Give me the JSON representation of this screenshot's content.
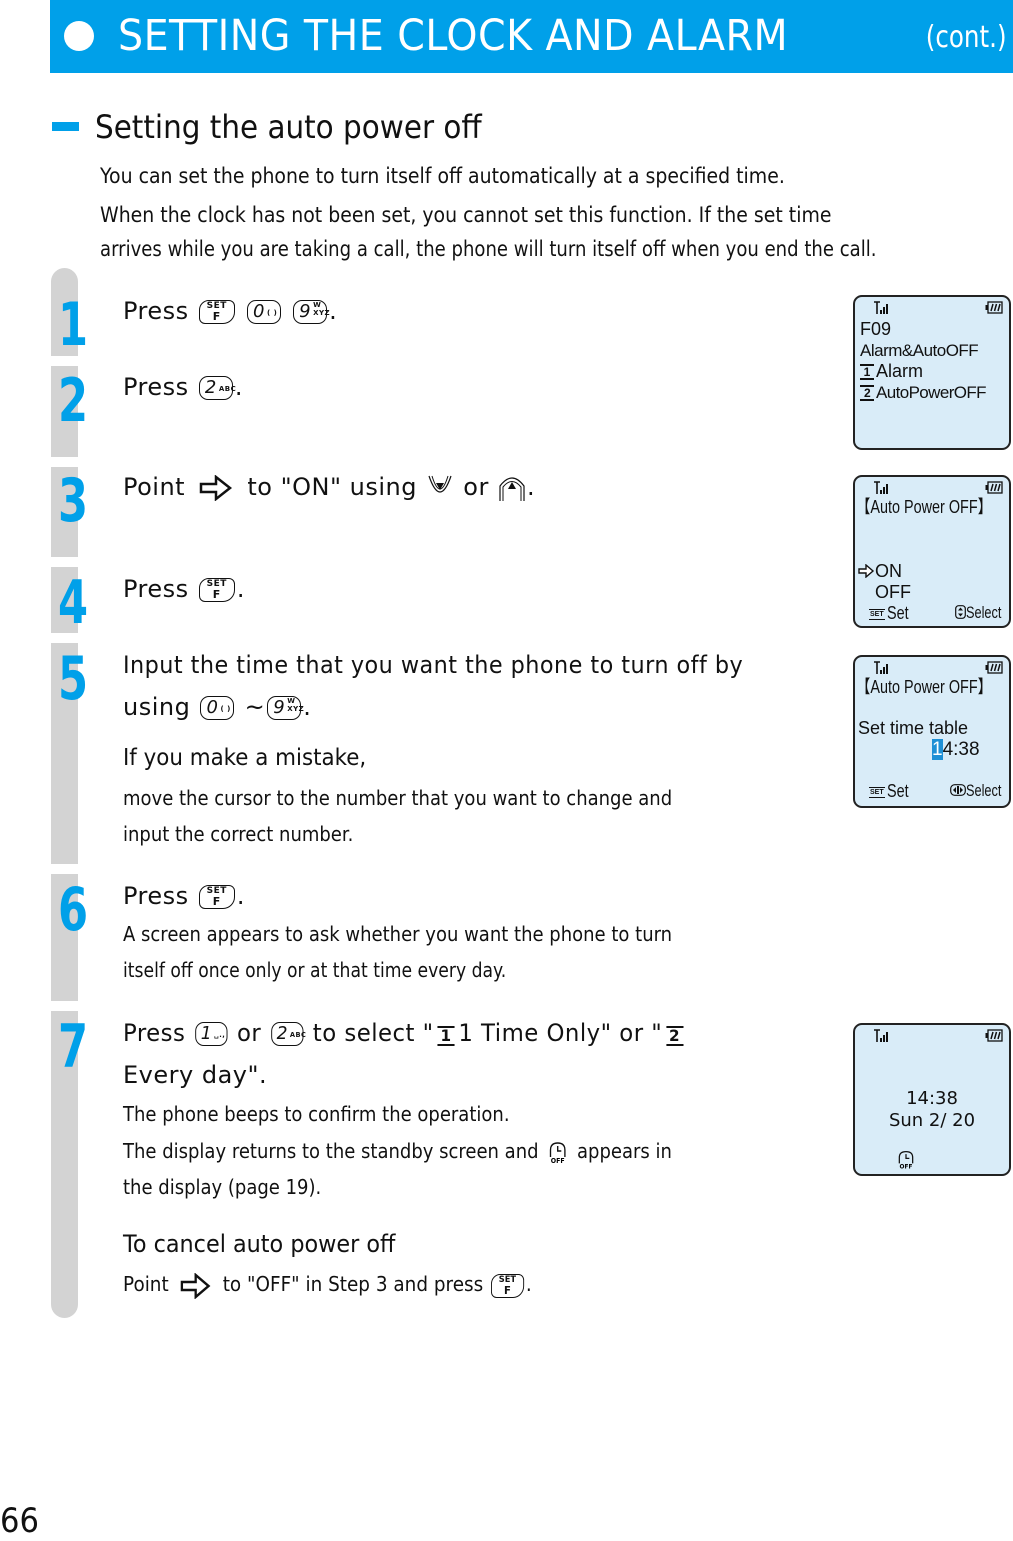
{
  "header": {
    "title": "SETTING THE CLOCK AND ALARM",
    "suffix": "(cont.)",
    "accent_color": "#00a0e9"
  },
  "section": {
    "title": "Setting the auto power off",
    "intro": [
      "You can set the phone to turn itself off automatically at a specified time.",
      "When the clock has not been set, you cannot set this function. If the set time",
      "arrives while you are taking a call, the phone will turn itself off when you end the call."
    ]
  },
  "keys": {
    "set_top": "SET",
    "set_bottom": "F",
    "k0_digit": "0",
    "k0_sub": "( )",
    "k9_digit": "9",
    "k9_sup": "W",
    "k9_sub": "XYZ",
    "k2_digit": "2",
    "k2_sub": "ABC",
    "k1_digit": "1",
    "k1_sub": "␣.,"
  },
  "steps": [
    {
      "number": "1",
      "prefix": "Press",
      "suffix": "."
    },
    {
      "number": "2",
      "prefix": "Press",
      "suffix": "."
    },
    {
      "number": "3",
      "prefix": "Point",
      "middle": "to \"ON\" using",
      "or": "or",
      "suffix": "."
    },
    {
      "number": "4",
      "prefix": "Press",
      "suffix": "."
    },
    {
      "number": "5",
      "line1": "Input the time that you want the phone to turn off by",
      "line2_prefix": "using",
      "line2_tilde": "~",
      "line2_suffix": ".",
      "note_title": "If you make a mistake,",
      "note_lines": [
        "move the cursor to the number that you want to change and",
        "input the correct number."
      ]
    },
    {
      "number": "6",
      "prefix": "Press",
      "suffix": ".",
      "detail_lines": [
        "A screen appears to ask whether you want the phone to turn",
        "itself off once only or at that time every day."
      ]
    },
    {
      "number": "7",
      "prefix": "Press",
      "or1": "or",
      "select_text": "to select \"",
      "opt1_box": "1",
      "opt1_label": "1 Time Only\" or \"",
      "opt2_box": "2",
      "line2": "Every day\".",
      "detail1": "The phone beeps to confirm the operation.",
      "detail2_prefix": "The display returns to the standby screen and",
      "detail2_suffix": "appears in",
      "detail3": "the display (page 19).",
      "cancel_title": "To cancel auto power off",
      "cancel_prefix": "Point",
      "cancel_middle": "to \"OFF\" in Step 3 and press",
      "cancel_suffix": "."
    }
  ],
  "displays": {
    "menu": {
      "code": "F09",
      "title": "Alarm&AutoOFF",
      "items": [
        {
          "box": "1",
          "label": "Alarm"
        },
        {
          "box": "2",
          "label": "AutoPowerOFF"
        }
      ]
    },
    "onoff": {
      "title": "【Auto Power OFF】",
      "options": [
        "ON",
        "OFF"
      ],
      "selected": "ON",
      "soft_left_icon": "SET",
      "soft_left": "Set",
      "soft_right": "Select"
    },
    "time": {
      "title": "【Auto Power OFF】",
      "label": "Set time table",
      "time_cursor_digit": "1",
      "time_rest": "4:38",
      "soft_left_icon": "SET",
      "soft_left": "Set",
      "soft_right": "Select"
    },
    "standby": {
      "time": "14:38",
      "date": "Sun 2/ 20"
    }
  },
  "page_number": "66"
}
